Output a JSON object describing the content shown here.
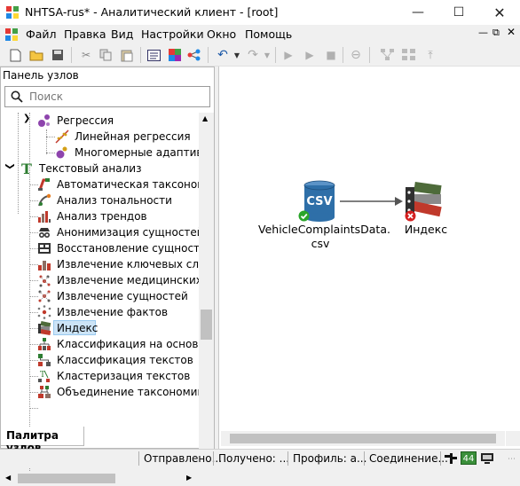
{
  "window": {
    "title": "NHTSA-rus* - Аналитический клиент - [root]"
  },
  "menu": [
    "Файл",
    "Правка",
    "Вид",
    "Настройки",
    "Окно",
    "Помощь"
  ],
  "left_panel": {
    "title": "Панель узлов",
    "search_placeholder": "Поиск",
    "tab": "Палитра узлов",
    "tree": [
      {
        "label": "Регрессия",
        "icon": "regression-icon"
      },
      {
        "label": "Линейная регрессия",
        "icon": "linear-regression-icon"
      },
      {
        "label": "Многомерные адаптивные",
        "icon": "mars-icon"
      },
      {
        "label": "Текстовый анализ",
        "icon": "text-analysis-icon"
      },
      {
        "label": "Автоматическая таксономия",
        "icon": "taxonomy-icon"
      },
      {
        "label": "Анализ тональности",
        "icon": "sentiment-icon"
      },
      {
        "label": "Анализ трендов",
        "icon": "trends-icon"
      },
      {
        "label": "Анонимизация сущностей",
        "icon": "anonymize-icon"
      },
      {
        "label": "Восстановление сущностей",
        "icon": "restore-icon"
      },
      {
        "label": "Извлечение ключевых слов",
        "icon": "keywords-icon"
      },
      {
        "label": "Извлечение медицинских сущ",
        "icon": "medical-icon"
      },
      {
        "label": "Извлечение сущностей",
        "icon": "entities-icon"
      },
      {
        "label": "Извлечение фактов",
        "icon": "facts-icon"
      },
      {
        "label": "Индекс",
        "icon": "index-icon"
      },
      {
        "label": "Классификация на основе та",
        "icon": "classification-icon"
      },
      {
        "label": "Классификация текстов",
        "icon": "text-classification-icon"
      },
      {
        "label": "Кластеризация текстов",
        "icon": "clustering-icon"
      },
      {
        "label": "Объединение таксономий",
        "icon": "merge-icon"
      }
    ]
  },
  "canvas": {
    "nodes": [
      {
        "label_line1": "VehicleComplaintsData.",
        "label_line2": "csv",
        "badge": "CSV",
        "status": "ok"
      },
      {
        "label_line1": "Индекс",
        "status": "error"
      }
    ]
  },
  "status_bar": {
    "sent": "Отправлено...",
    "received": "Получено: ...",
    "profile": "Профиль: а...",
    "connection": "Соединение...",
    "count": "44"
  },
  "colors": {
    "csv_node": "#2e6fa8",
    "ok": "#2aa52a",
    "error": "#d42020",
    "selection": "#cce4f7"
  }
}
